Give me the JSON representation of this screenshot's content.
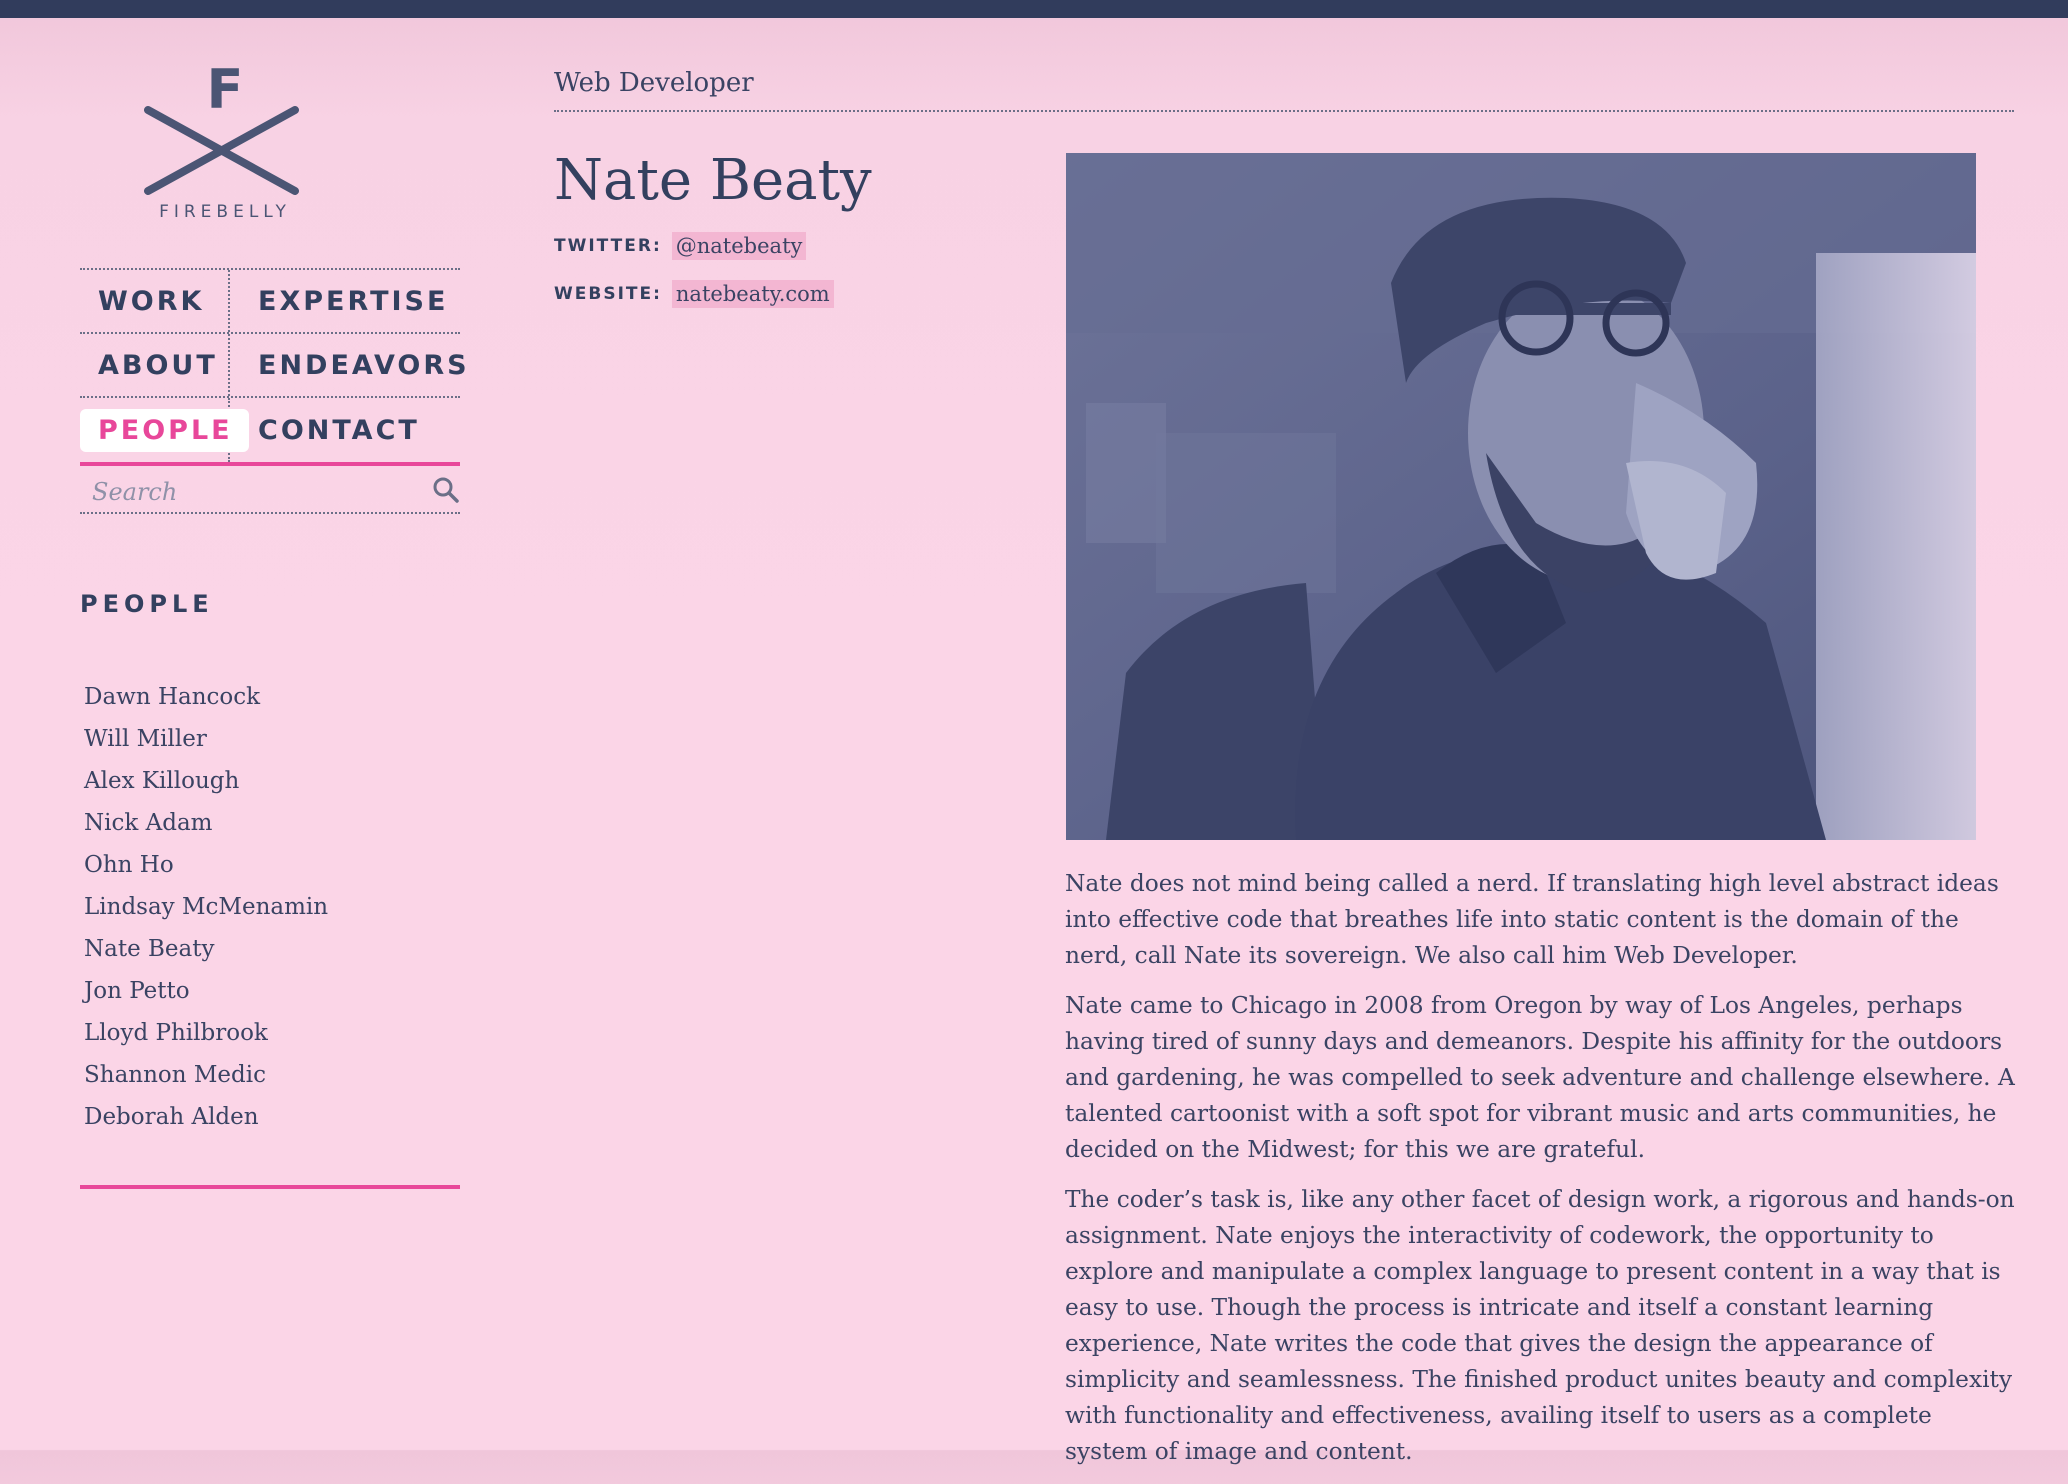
{
  "logo": {
    "letter": "F",
    "wordmark": "FIREBELLY"
  },
  "nav": {
    "items": [
      {
        "label": "WORK"
      },
      {
        "label": "EXPERTISE"
      },
      {
        "label": "ABOUT"
      },
      {
        "label": "ENDEAVORS"
      },
      {
        "label": "PEOPLE",
        "active": true
      },
      {
        "label": "CONTACT"
      }
    ]
  },
  "search": {
    "placeholder": "Search",
    "value": ""
  },
  "sidebar": {
    "title": "PEOPLE",
    "people": [
      "Dawn Hancock",
      "Will Miller",
      "Alex Killough",
      "Nick Adam",
      "Ohn Ho",
      "Lindsay McMenamin",
      "Nate Beaty",
      "Jon Petto",
      "Lloyd Philbrook",
      "Shannon Medic",
      "Deborah Alden"
    ]
  },
  "profile": {
    "role": "Web Developer",
    "name": "Nate Beaty",
    "twitter_label": "TWITTER:",
    "twitter": "@natebeaty",
    "website_label": "WEBSITE:",
    "website": "natebeaty.com",
    "bio": [
      "Nate does not mind being called a nerd. If translating high level abstract ideas into effective code that breathes life into static content is the domain of the nerd, call Nate its sovereign. We also call him Web Developer.",
      "Nate came to Chicago in 2008 from Oregon by way of Los Angeles, perhaps having tired of sunny days and demeanors. Despite his affinity for the outdoors and gardening, he was compelled to seek adventure and challenge elsewhere. A talented cartoonist with a soft spot for vibrant music and arts communities, he decided on the Midwest; for this we are grateful.",
      "The coder’s task is, like any other facet of design work, a rigorous and hands-on assignment. Nate enjoys the interactivity of codework, the opportunity to explore and manipulate a complex language to present content in a way that is easy to use. Though the process is intricate and itself a constant learning experience, Nate writes the code that gives the design the appearance of simplicity and seamlessness. The finished product unites beauty and complexity with functionality and effectiveness, availing itself to users as a complete system of image and content."
    ]
  },
  "colors": {
    "accent": "#e8479a",
    "navy": "#313c5c",
    "background": "#fbd5e7"
  }
}
